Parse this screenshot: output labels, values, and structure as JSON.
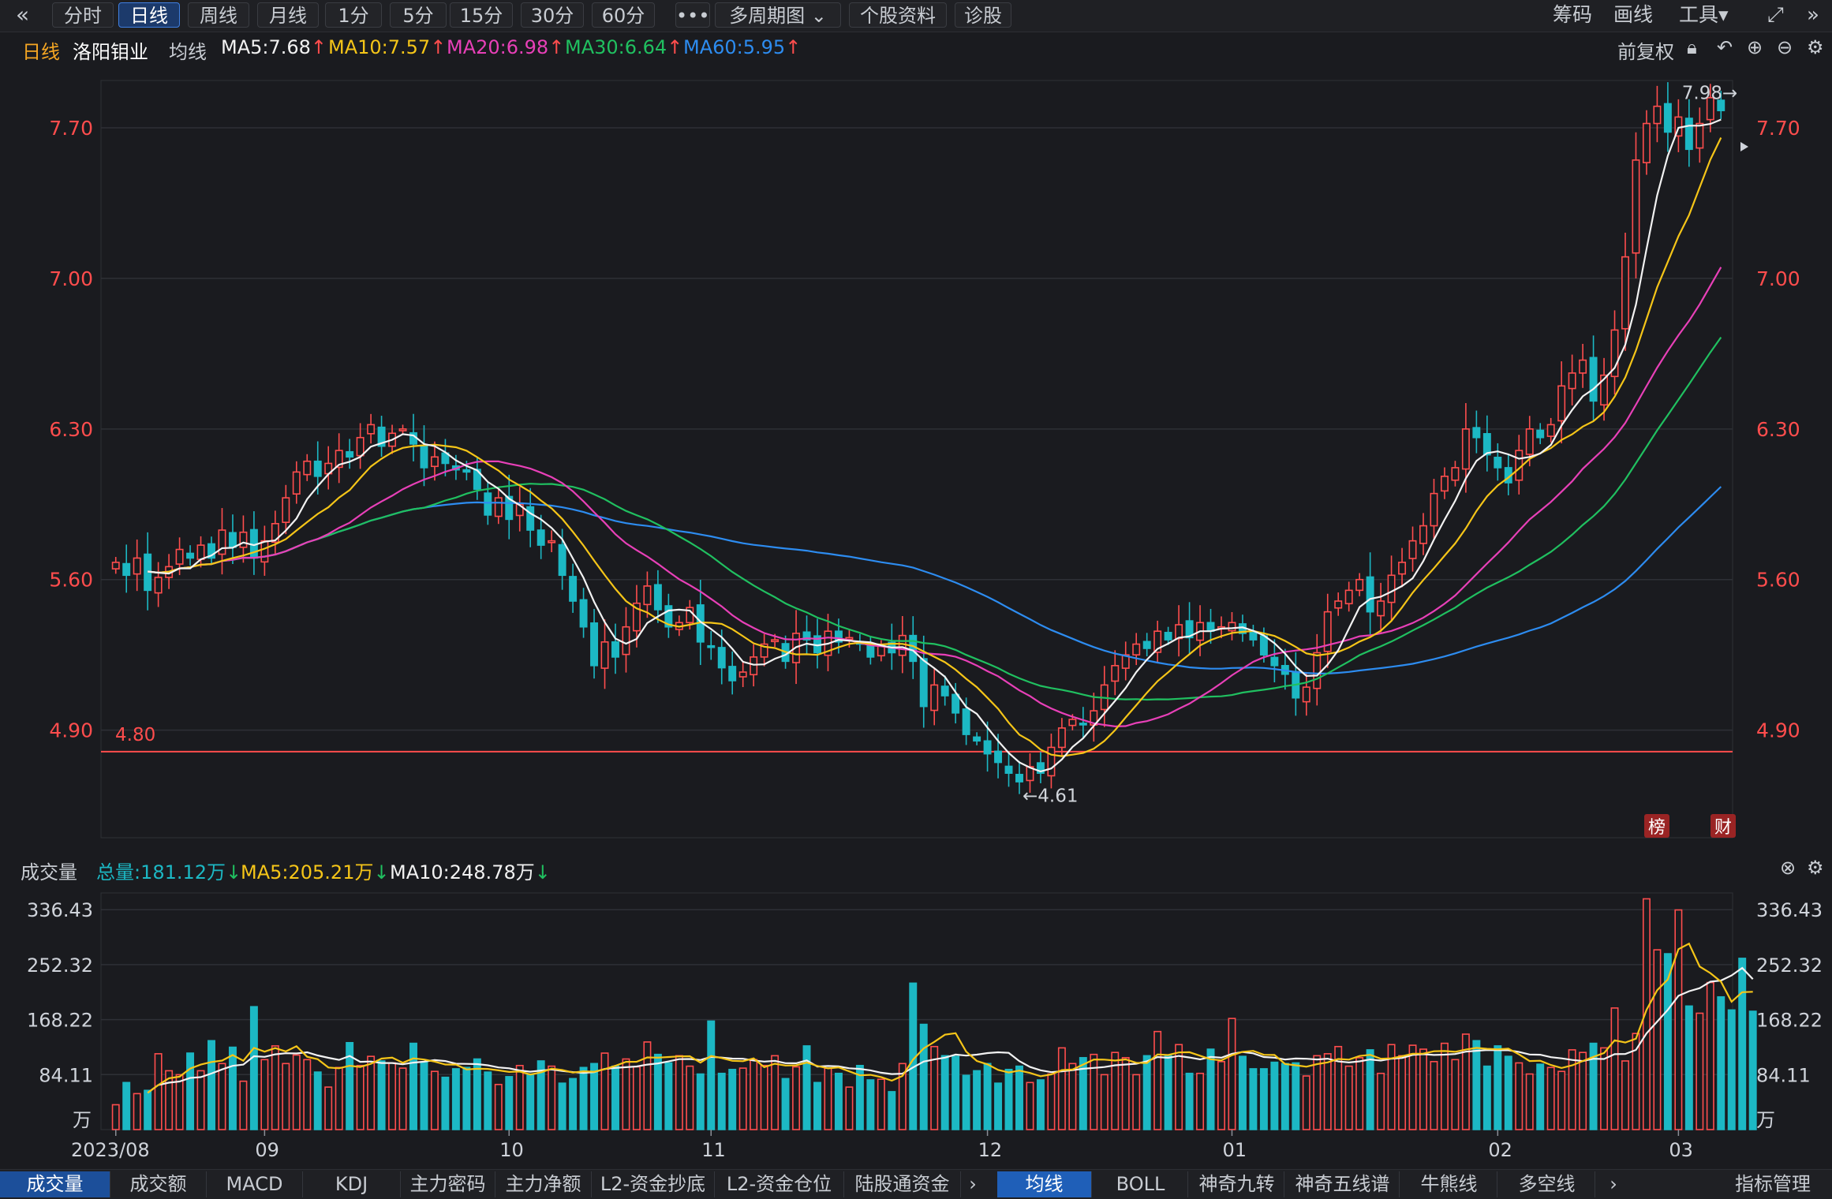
{
  "toolbar": {
    "back_icon": "double-chevron-left-icon",
    "tabs": [
      {
        "label": "分时",
        "active": false
      },
      {
        "label": "日线",
        "active": true
      },
      {
        "label": "周线",
        "active": false
      },
      {
        "label": "月线",
        "active": false
      },
      {
        "label": "1分",
        "active": false
      },
      {
        "label": "5分",
        "active": false
      },
      {
        "label": "15分",
        "active": false
      },
      {
        "label": "30分",
        "active": false
      },
      {
        "label": "60分",
        "active": false
      },
      {
        "label": "•••",
        "active": false
      },
      {
        "label": "多周期图 ⌄",
        "active": false
      },
      {
        "label": "个股资料",
        "active": false
      },
      {
        "label": "诊股",
        "active": false
      }
    ],
    "right": {
      "chouma": "筹码",
      "huaxian": "画线",
      "gongju": "工具▾"
    }
  },
  "info": {
    "period": "日线",
    "stock": "洛阳钼业",
    "ma_label": "均线",
    "ma5": "MA5:7.68",
    "ma10": "MA10:7.57",
    "ma20": "MA20:6.98",
    "ma30": "MA30:6.64",
    "ma60": "MA60:5.95",
    "fuquan": "前复权"
  },
  "colors": {
    "up": "#ff4d4d",
    "down": "#1cb8c4",
    "ma5": "#f2f2f2",
    "ma10": "#f5c518",
    "ma20": "#e840b8",
    "ma30": "#20c060",
    "ma60": "#2d8cf0",
    "grid": "#2e3036",
    "axis_text": "#ff4d4d",
    "line480": "#ff4d4d"
  },
  "volume_info": {
    "label": "成交量",
    "total": "总量:181.12万",
    "ma5": "MA5:205.21万",
    "ma10": "MA10:248.78万"
  },
  "chart_data": [
    {
      "type": "candlestick",
      "title": "洛阳钼业 日线 前复权",
      "y_ticks": [
        "7.70",
        "7.00",
        "6.30",
        "5.60",
        "4.90"
      ],
      "ylim": [
        4.4,
        7.92
      ],
      "horizontal_line": {
        "value": 4.8,
        "label": "4.80"
      },
      "annotations": {
        "high": "7.98→",
        "low": "←4.61"
      },
      "x_month_labels": [
        "2023/08",
        "09",
        "10",
        "11",
        "12",
        "01",
        "02",
        "03"
      ],
      "badges": [
        "榜",
        "财"
      ],
      "closes": [
        5.68,
        5.62,
        5.7,
        5.55,
        5.61,
        5.66,
        5.74,
        5.7,
        5.76,
        5.7,
        5.83,
        5.75,
        5.82,
        5.7,
        5.78,
        5.86,
        5.98,
        6.1,
        6.15,
        6.08,
        6.14,
        6.2,
        6.17,
        6.26,
        6.32,
        6.22,
        6.28,
        6.3,
        6.23,
        6.12,
        6.17,
        6.14,
        6.11,
        6.1,
        6.02,
        5.9,
        5.98,
        5.88,
        5.95,
        5.83,
        5.76,
        5.78,
        5.62,
        5.5,
        5.38,
        5.2,
        5.31,
        5.24,
        5.38,
        5.49,
        5.57,
        5.46,
        5.38,
        5.4,
        5.47,
        5.31,
        5.29,
        5.19,
        5.13,
        5.17,
        5.24,
        5.3,
        5.32,
        5.22,
        5.35,
        5.32,
        5.26,
        5.36,
        5.31,
        5.33,
        5.3,
        5.24,
        5.29,
        5.26,
        5.34,
        5.22,
        5.01,
        5.11,
        5.06,
        4.98,
        4.88,
        4.85,
        4.79,
        4.75,
        4.7,
        4.66,
        4.73,
        4.7,
        4.82,
        4.91,
        4.95,
        4.93,
        4.99,
        5.11,
        5.2,
        5.25,
        5.3,
        5.28,
        5.36,
        5.32,
        5.39,
        5.33,
        5.4,
        5.36,
        5.38,
        5.4,
        5.35,
        5.32,
        5.25,
        5.2,
        5.16,
        5.05,
        5.1,
        5.26,
        5.45,
        5.5,
        5.55,
        5.6,
        5.45,
        5.5,
        5.62,
        5.68,
        5.78,
        5.85,
        6.0,
        6.08,
        6.12,
        6.3,
        6.26,
        6.18,
        6.12,
        6.05,
        6.2,
        6.3,
        6.26,
        6.32,
        6.5,
        6.56,
        6.62,
        6.43,
        6.55,
        6.76,
        7.1,
        7.55,
        7.72,
        7.8,
        7.68,
        7.75,
        7.6,
        7.72,
        7.84,
        7.78
      ],
      "volumes": [
        38,
        72,
        55,
        60,
        116,
        90,
        84,
        117,
        90,
        136,
        101,
        126,
        74,
        188,
        107,
        128,
        101,
        114,
        107,
        88,
        65,
        95,
        133,
        98,
        112,
        105,
        102,
        94,
        132,
        103,
        89,
        80,
        93,
        95,
        108,
        88,
        69,
        81,
        98,
        85,
        105,
        97,
        71,
        78,
        95,
        101,
        117,
        97,
        108,
        96,
        134,
        115,
        102,
        113,
        97,
        85,
        166,
        86,
        92,
        94,
        107,
        98,
        113,
        78,
        96,
        128,
        72,
        94,
        86,
        65,
        98,
        76,
        77,
        58,
        101,
        224,
        161,
        127,
        113,
        112,
        83,
        90,
        101,
        71,
        92,
        97,
        72,
        76,
        85,
        125,
        101,
        110,
        115,
        84,
        118,
        110,
        84,
        113,
        150,
        113,
        130,
        86,
        86,
        123,
        104,
        170,
        112,
        93,
        93,
        103,
        101,
        102,
        82,
        113,
        116,
        127,
        97,
        110,
        122,
        86,
        130,
        113,
        129,
        123,
        104,
        132,
        107,
        146,
        136,
        97,
        128,
        112,
        102,
        85,
        100,
        95,
        89,
        122,
        118,
        132,
        125,
        186,
        105,
        147,
        353,
        275,
        269,
        336,
        189,
        178,
        225,
        203,
        183,
        262,
        181
      ],
      "volume_y_ticks": [
        "336.43",
        "252.32",
        "168.22",
        "84.11"
      ],
      "volume_unit": "万"
    }
  ],
  "bottom_tabs_left": [
    {
      "label": "成交量",
      "active": true
    },
    {
      "label": "成交额"
    },
    {
      "label": "MACD"
    },
    {
      "label": "KDJ"
    },
    {
      "label": "主力密码"
    },
    {
      "label": "主力净额"
    },
    {
      "label": "L2-资金抄底"
    },
    {
      "label": "L2-资金仓位"
    },
    {
      "label": "陆股通资金"
    }
  ],
  "bottom_tabs_right": [
    {
      "label": "均线",
      "active": true
    },
    {
      "label": "BOLL"
    },
    {
      "label": "神奇九转"
    },
    {
      "label": "神奇五线谱"
    },
    {
      "label": "牛熊线"
    },
    {
      "label": "多空线"
    }
  ],
  "indicator_manage": "指标管理"
}
